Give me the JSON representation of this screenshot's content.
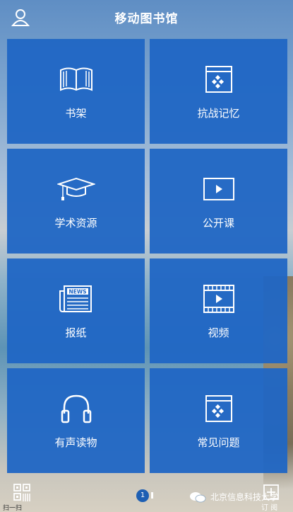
{
  "header": {
    "title": "移动图书馆",
    "user_icon": "user-icon"
  },
  "tiles": [
    {
      "label": "书架",
      "icon": "book-icon"
    },
    {
      "label": "抗战记忆",
      "icon": "app-frame-icon"
    },
    {
      "label": "学术资源",
      "icon": "graduation-cap-icon"
    },
    {
      "label": "公开课",
      "icon": "play-screen-icon"
    },
    {
      "label": "报纸",
      "icon": "newspaper-icon"
    },
    {
      "label": "视频",
      "icon": "film-icon"
    },
    {
      "label": "有声读物",
      "icon": "headphones-icon"
    },
    {
      "label": "常见问题",
      "icon": "app-frame-icon"
    }
  ],
  "newspaper_badge": "NEWS",
  "bottom": {
    "scan_label": "扫一扫",
    "page_number": "1",
    "watermark": "北京信息科技大学",
    "subscribe_label": "订 阅"
  },
  "colors": {
    "tile": "#2066c4",
    "page_dot": "#1e5fb3"
  }
}
